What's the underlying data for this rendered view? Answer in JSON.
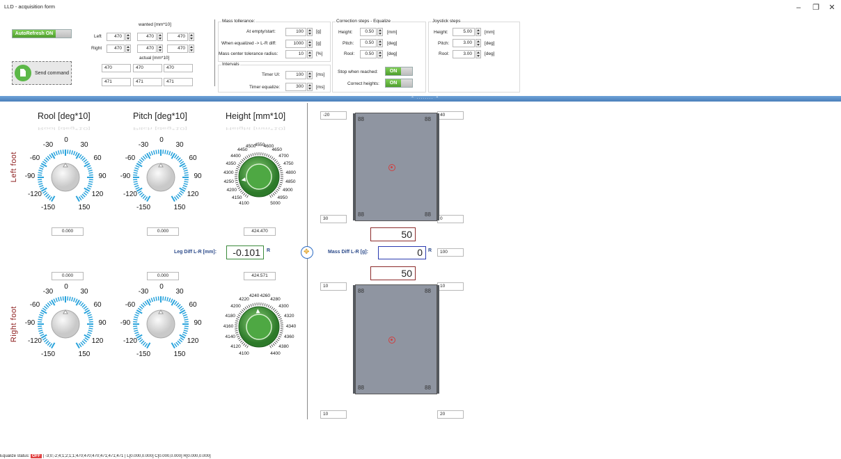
{
  "window": {
    "title": "LLD - acquisition form",
    "minimize": "–",
    "maximize": "❐",
    "close": "✕"
  },
  "top": {
    "autorefresh_label": "AutoRefresh ON",
    "wanted_label": "wanted [mm*10]",
    "actual_label": "actual [mm*10]",
    "left_label": "Left",
    "right_label": "Right",
    "wanted_left": [
      "470",
      "470",
      "470"
    ],
    "wanted_right": [
      "470",
      "470",
      "470"
    ],
    "actual_row1": [
      "470",
      "470",
      "470"
    ],
    "actual_row2": [
      "471",
      "471",
      "471"
    ],
    "send_label": "Send command"
  },
  "mass": {
    "title": "Mass tollerance:",
    "empty_label": "At empty/start:",
    "empty_value": "100",
    "empty_unit": "[g]",
    "equalized_label": "When equalized -> L-R diff:",
    "equalized_value": "1000",
    "equalized_unit": "[g]",
    "radius_label": "Mass center tolerance radius:",
    "radius_value": "10",
    "radius_unit": "[%]"
  },
  "intervals": {
    "title": "Intervals",
    "ui_label": "Timer UI:",
    "ui_value": "100",
    "ui_unit": "[ms]",
    "eq_label": "Timer equalize:",
    "eq_value": "300",
    "eq_unit": "[ms]"
  },
  "correction": {
    "title": "Correction steps - Equalize",
    "height_label": "Height:",
    "height_value": "0.50",
    "height_unit": "[mm]",
    "pitch_label": "Pitch:",
    "pitch_value": "0.50",
    "pitch_unit": "[deg]",
    "rool_label": "Rool:",
    "rool_value": "0.50",
    "rool_unit": "[deg]",
    "stop_label": "Stop when reached:",
    "stop_state": "ON",
    "correct_label": "Correct heights:",
    "correct_state": "ON"
  },
  "joystick": {
    "title": "Joystick steps",
    "height_label": "Height:",
    "height_value": "5.00",
    "height_unit": "[mm]",
    "pitch_label": "Pitch:",
    "pitch_value": "3.00",
    "pitch_unit": "[deg]",
    "rool_label": "Rool:",
    "rool_value": "3.00",
    "rool_unit": "[deg]"
  },
  "splitter_grip": "⌃ ········ ⌃",
  "dials": {
    "rool_title": "Rool [deg*10]",
    "pitch_title": "Pitch  [deg*10]",
    "height_title": "Height [mm*10]",
    "angle_ticks": [
      "0",
      "30",
      "60",
      "90",
      "120",
      "150",
      "-30",
      "-60",
      "-90",
      "-120",
      "-150"
    ],
    "left_height_ticks": [
      "4100",
      "4150",
      "4200",
      "4250",
      "4300",
      "4350",
      "4400",
      "4450",
      "4500",
      "4550",
      "4600",
      "4650",
      "4700",
      "4750",
      "4800",
      "4850",
      "4900",
      "4950",
      "5000"
    ],
    "right_height_ticks": [
      "4100",
      "4120",
      "4140",
      "4160",
      "4180",
      "4200",
      "4220",
      "4240",
      "4260",
      "4280",
      "4300",
      "4320",
      "4340",
      "4360",
      "4380",
      "4400"
    ]
  },
  "left_foot": {
    "label": "Left  foot",
    "rool_value": "0.000",
    "pitch_value": "0.000",
    "height_value": "424.470",
    "height_level": 4245
  },
  "right_foot": {
    "label": "Right  foot",
    "rool_value": "0.000",
    "pitch_value": "0.000",
    "height_value": "424.571",
    "height_level": 4246
  },
  "legdiff": {
    "label": "Leg Diff L-R [mm]:",
    "value": "-0.101",
    "suffix": "R"
  },
  "massdiff": {
    "label": "Mass Diff L-R [g]:",
    "value": "0",
    "suffix": "R",
    "top_value": "50",
    "bottom_value": "50",
    "side_value": "100"
  },
  "sensors": {
    "upper": {
      "tl": "-20",
      "tr": "40",
      "bl": "30",
      "br": "0"
    },
    "lower": {
      "tl": "10",
      "tr": "10",
      "bl": "10",
      "br": "20"
    }
  },
  "status": {
    "label": "Equalize status:",
    "state": "OFF",
    "detail": "| -3;0;-2;4;1;2;1;1;470;470;470;471;471;471 | L[0.000,0.000] C[0.000,0.000] R[0.000,0.000]"
  }
}
